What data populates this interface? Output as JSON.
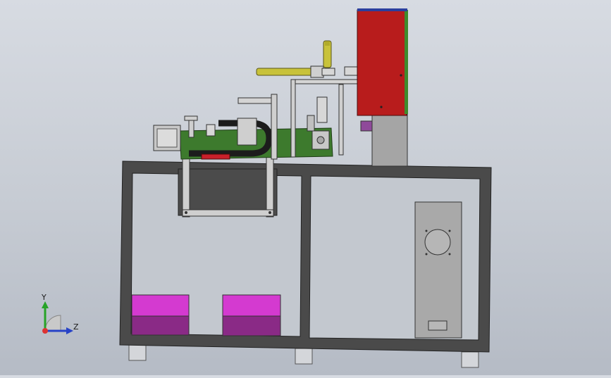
{
  "window": {
    "view": "cad-model-viewport"
  },
  "triad": {
    "y_label": "Y",
    "z_label": "Z"
  },
  "colors": {
    "background_top": "#d7dbe2",
    "background_bottom": "#b5bbc5",
    "frame": "#4a4a4a",
    "panel": "#a9a9a9",
    "enclosure_red": "#b81c1c",
    "enclosure_green": "#3f8a2c",
    "enclosure_top_blue": "#2b3f9e",
    "cylinder_yellow": "#c8c23a",
    "pcb_green": "#3d7a2d",
    "magenta_box": "#c03cbc",
    "leg_gray": "#cfd2d6"
  }
}
